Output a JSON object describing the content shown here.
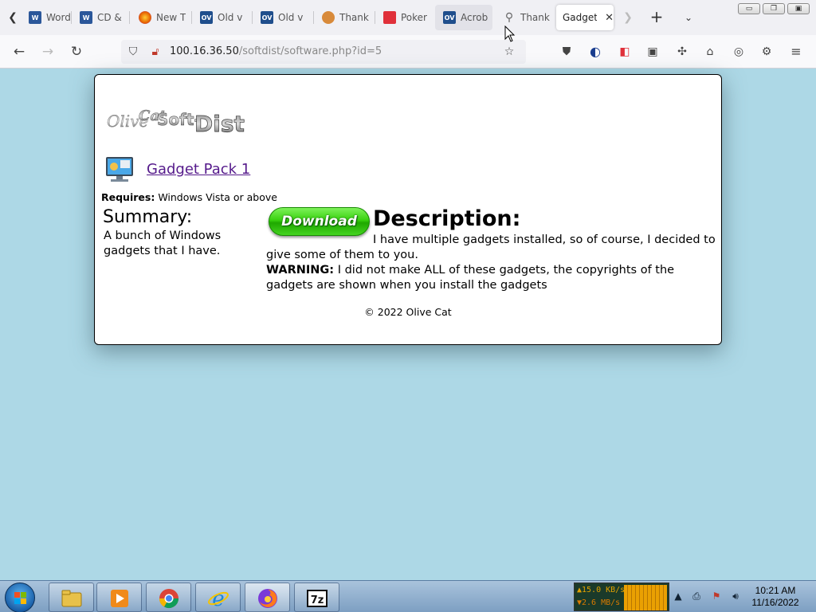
{
  "browser": {
    "tabs": [
      {
        "label": "Word",
        "favicon": "word-icon",
        "color": "#2b579a",
        "glyph": "W"
      },
      {
        "label": "CD &",
        "favicon": "word-icon",
        "color": "#2b579a",
        "glyph": "W"
      },
      {
        "label": "New T",
        "favicon": "firefox-icon",
        "color": "#e66000",
        "glyph": ""
      },
      {
        "label": "Old v",
        "favicon": "ov-icon",
        "color": "#1f4e8c",
        "glyph": "OV"
      },
      {
        "label": "Old v",
        "favicon": "ov-icon",
        "color": "#1f4e8c",
        "glyph": "OV"
      },
      {
        "label": "Thank",
        "favicon": "thanks-icon",
        "color": "#d88a3a",
        "glyph": ""
      },
      {
        "label": "Poker",
        "favicon": "poker-icon",
        "color": "#e0303a",
        "glyph": ""
      },
      {
        "label": "Acrob",
        "favicon": "ov-icon",
        "color": "#1f4e8c",
        "glyph": "OV"
      },
      {
        "label": "Thank",
        "favicon": "search-icon",
        "color": "#666666",
        "glyph": ""
      },
      {
        "label": "Gadget",
        "favicon": "none",
        "color": "#ffffff",
        "glyph": ""
      }
    ],
    "active_tab_index": 9,
    "url": {
      "host": "100.16.36.50",
      "path": "/softdist/software.php?id=5"
    }
  },
  "page": {
    "logo_text": "OliveCatSoft-Dist",
    "software": {
      "title": "Gadget Pack 1",
      "requires_label": "Requires:",
      "requires_value": "Windows Vista or above"
    },
    "summary": {
      "heading": "Summary:",
      "text": "A bunch of Windows gadgets that I have."
    },
    "download_label": "Download",
    "description": {
      "heading": "Description:",
      "text": "I have multiple gadgets installed, so of course, I decided to give some of them to you.",
      "warning_label": "WARNING:",
      "warning_text": "I did not make ALL of these gadgets, the copyrights of the gadgets are shown when you install the gadgets"
    },
    "footer": "© 2022 Olive Cat"
  },
  "taskbar": {
    "apps": [
      {
        "name": "file-explorer",
        "color": "#e8c14a"
      },
      {
        "name": "media-player",
        "color": "#f08a1a"
      },
      {
        "name": "chrome",
        "color": "#3a9a3a"
      },
      {
        "name": "internet-explorer",
        "color": "#1e88d8"
      },
      {
        "name": "firefox",
        "color": "#e66000"
      },
      {
        "name": "7zip",
        "color": "#111111"
      }
    ],
    "seven_zip_label": "7z",
    "net_up": "▲15.0 KB/s",
    "net_down": "▼2.6 MB/s",
    "time": "10:21 AM",
    "date": "11/16/2022"
  },
  "colors": {
    "page_bg": "#add8e6",
    "link": "#551a8b",
    "download_green": "#39d10f"
  }
}
